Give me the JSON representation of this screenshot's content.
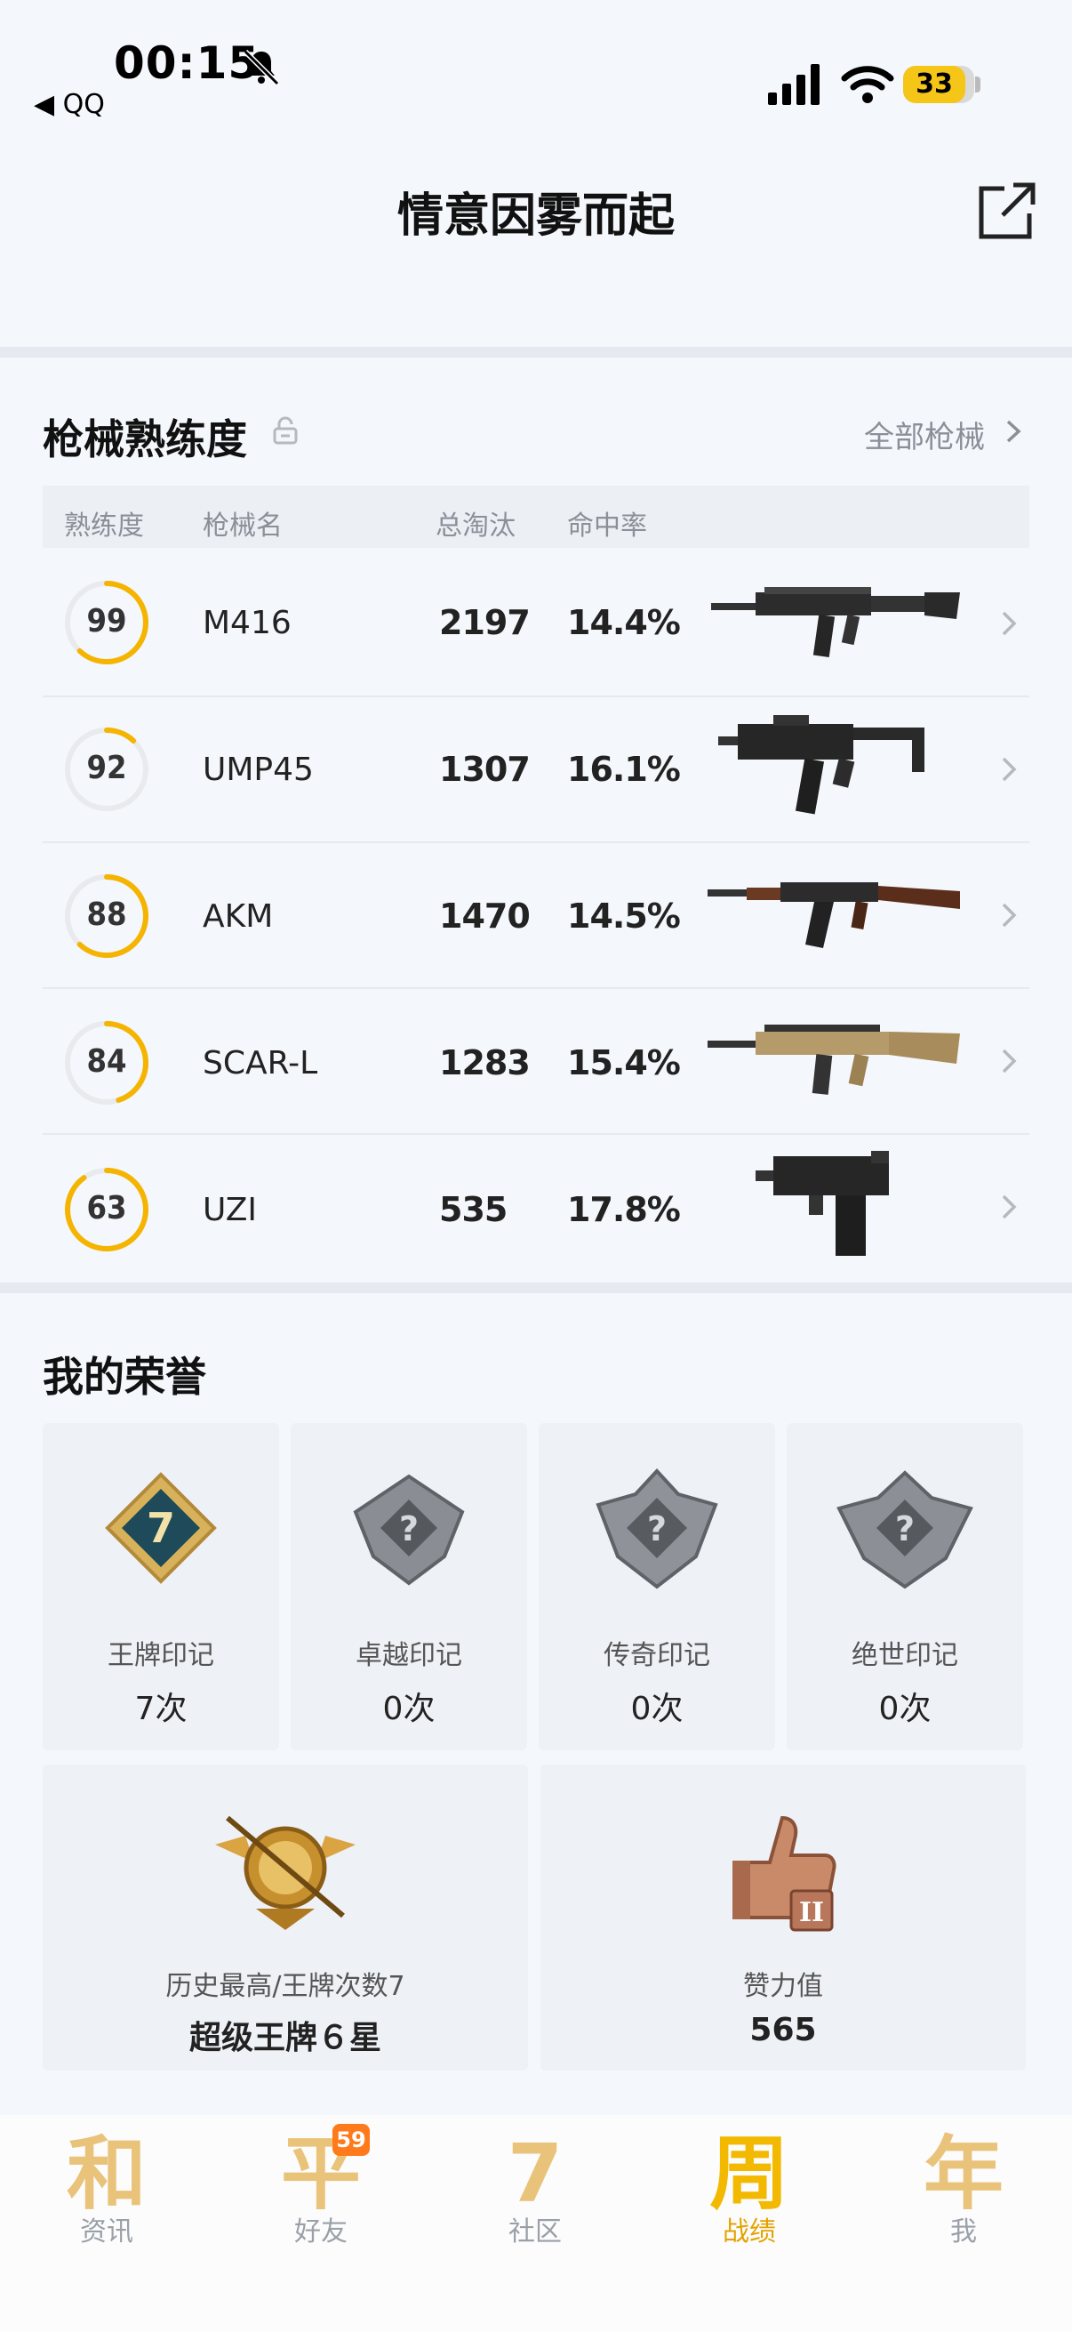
{
  "status_bar": {
    "time": "00:15",
    "back_app": "◀ QQ",
    "battery": "33"
  },
  "header": {
    "title": "情意因雾而起"
  },
  "gun_section": {
    "title": "枪械熟练度",
    "all_link": "全部枪械",
    "columns": [
      "熟练度",
      "枪械名",
      "总淘汰",
      "命中率"
    ],
    "rows": [
      {
        "proficiency": 99,
        "progress": 0.62,
        "name": "M416",
        "eliminations": "2197",
        "accuracy": "14.4%"
      },
      {
        "proficiency": 92,
        "progress": 0.12,
        "name": "UMP45",
        "eliminations": "1307",
        "accuracy": "16.1%"
      },
      {
        "proficiency": 88,
        "progress": 0.62,
        "name": "AKM",
        "eliminations": "1470",
        "accuracy": "14.5%"
      },
      {
        "proficiency": 84,
        "progress": 0.45,
        "name": "SCAR-L",
        "eliminations": "1283",
        "accuracy": "15.4%"
      },
      {
        "proficiency": 63,
        "progress": 0.9,
        "name": "UZI",
        "eliminations": "535",
        "accuracy": "17.8%"
      }
    ]
  },
  "honor_section": {
    "title": "我的荣誉",
    "marks": [
      {
        "label": "王牌印记",
        "value": "7次",
        "icon": "ace-mark-icon"
      },
      {
        "label": "卓越印记",
        "value": "0次",
        "icon": "excellence-mark-icon"
      },
      {
        "label": "传奇印记",
        "value": "0次",
        "icon": "legend-mark-icon"
      },
      {
        "label": "绝世印记",
        "value": "0次",
        "icon": "peerless-mark-icon"
      }
    ],
    "highest": {
      "label": "历史最高/王牌次数7",
      "value": "超级王牌６星"
    },
    "likes": {
      "label": "赞力值",
      "value": "565"
    }
  },
  "tab_bar": {
    "items": [
      {
        "glyph": "和",
        "label": "资讯"
      },
      {
        "glyph": "平",
        "label": "好友",
        "badge": "59"
      },
      {
        "glyph": "7",
        "label": "社区"
      },
      {
        "glyph": "周",
        "label": "战绩",
        "active": true
      },
      {
        "glyph": "年",
        "label": "我"
      }
    ]
  },
  "colors": {
    "accent": "#f5b400",
    "ring_track": "#e8eaee",
    "background": "#f4f7fb"
  }
}
